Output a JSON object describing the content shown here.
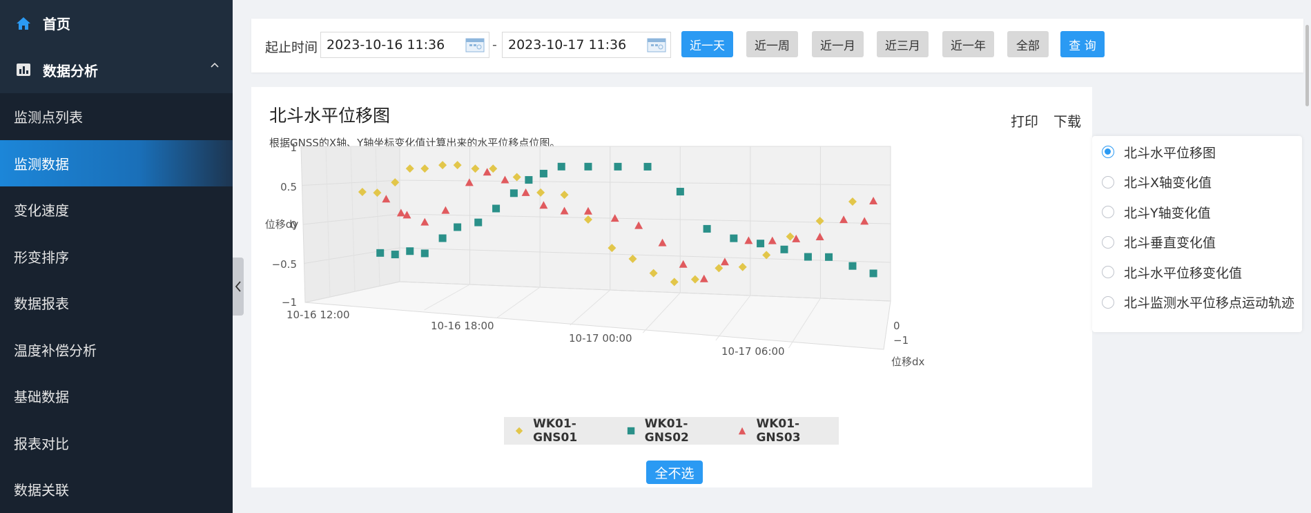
{
  "sidebar": {
    "home": "首页",
    "group": "数据分析",
    "items": [
      {
        "label": "监测点列表",
        "active": false
      },
      {
        "label": "监测数据",
        "active": true
      },
      {
        "label": "变化速度",
        "active": false
      },
      {
        "label": "形变排序",
        "active": false
      },
      {
        "label": "数据报表",
        "active": false
      },
      {
        "label": "温度补偿分析",
        "active": false
      },
      {
        "label": "基础数据",
        "active": false
      },
      {
        "label": "报表对比",
        "active": false
      },
      {
        "label": "数据关联",
        "active": false
      }
    ]
  },
  "filter": {
    "label": "起止时间",
    "start": "2023-10-16 11:36",
    "separator": "-",
    "end": "2023-10-17 11:36",
    "quick": [
      "近一天",
      "近一周",
      "近一月",
      "近三月",
      "近一年",
      "全部"
    ],
    "query": "查 询"
  },
  "panel": {
    "title": "北斗水平位移图",
    "subtitle": "根据GNSS的X轴、Y轴坐标变化值计算出来的水平位移点位图。",
    "print": "打印",
    "download": "下载",
    "clear_all": "全不选"
  },
  "options": [
    "北斗水平位移图",
    "北斗X轴变化值",
    "北斗Y轴变化值",
    "北斗垂直变化值",
    "北斗水平位移变化值",
    "北斗监测水平位移点运动轨迹"
  ],
  "chart_data": {
    "type": "scatter",
    "title": "",
    "x_axis": {
      "label": "",
      "ticks": [
        "10-16 12:00",
        "10-16 18:00",
        "10-17 00:00",
        "10-17 06:00"
      ]
    },
    "y_axis": {
      "label": "位移dy",
      "ticks": [
        "1",
        "0.5",
        "0",
        "−0.5",
        "−1"
      ],
      "ylim": [
        -1,
        1
      ]
    },
    "z_axis": {
      "label": "位移dx",
      "ticks": [
        "0",
        "−1"
      ]
    },
    "grid": true,
    "legend_position": "bottom",
    "series": [
      {
        "name": "WK01-GNS01",
        "color": "#e2c64a",
        "shape": "diamond",
        "points": [
          [
            11.8,
            0.48
          ],
          [
            12.3,
            0.47
          ],
          [
            12.9,
            0.62
          ],
          [
            13.4,
            0.82
          ],
          [
            13.9,
            0.82
          ],
          [
            14.5,
            0.87
          ],
          [
            15.0,
            0.87
          ],
          [
            15.6,
            0.82
          ],
          [
            16.2,
            0.82
          ],
          [
            17.0,
            0.7
          ],
          [
            17.8,
            0.48
          ],
          [
            18.6,
            0.45
          ],
          [
            19.4,
            0.1
          ],
          [
            20.2,
            -0.3
          ],
          [
            20.9,
            -0.45
          ],
          [
            21.6,
            -0.65
          ],
          [
            22.3,
            -0.77
          ],
          [
            23.0,
            -0.73
          ],
          [
            23.8,
            -0.57
          ],
          [
            24.6,
            -0.55
          ],
          [
            25.4,
            -0.38
          ],
          [
            26.2,
            -0.12
          ],
          [
            27.2,
            0.1
          ],
          [
            28.3,
            0.37
          ]
        ]
      },
      {
        "name": "WK01-GNS02",
        "color": "#2a9089",
        "shape": "square",
        "points": [
          [
            12.4,
            -0.4
          ],
          [
            12.9,
            -0.42
          ],
          [
            13.4,
            -0.37
          ],
          [
            13.9,
            -0.4
          ],
          [
            14.5,
            -0.18
          ],
          [
            15.0,
            -0.02
          ],
          [
            15.7,
            0.05
          ],
          [
            16.3,
            0.25
          ],
          [
            16.9,
            0.47
          ],
          [
            17.4,
            0.66
          ],
          [
            17.9,
            0.75
          ],
          [
            18.5,
            0.85
          ],
          [
            19.4,
            0.85
          ],
          [
            20.4,
            0.85
          ],
          [
            21.4,
            0.85
          ],
          [
            22.5,
            0.5
          ],
          [
            23.4,
            -0.02
          ],
          [
            24.3,
            -0.15
          ],
          [
            25.2,
            -0.22
          ],
          [
            26.0,
            -0.3
          ],
          [
            26.8,
            -0.4
          ],
          [
            27.5,
            -0.4
          ],
          [
            28.3,
            -0.52
          ],
          [
            29.0,
            -0.62
          ]
        ]
      },
      {
        "name": "WK01-GNS03",
        "color": "#e05a5e",
        "shape": "triangle",
        "points": [
          [
            12.6,
            0.38
          ],
          [
            13.1,
            0.18
          ],
          [
            13.3,
            0.15
          ],
          [
            13.9,
            0.05
          ],
          [
            14.6,
            0.22
          ],
          [
            15.4,
            0.62
          ],
          [
            16.0,
            0.77
          ],
          [
            16.6,
            0.66
          ],
          [
            17.3,
            0.48
          ],
          [
            17.9,
            0.3
          ],
          [
            18.6,
            0.22
          ],
          [
            19.4,
            0.22
          ],
          [
            20.3,
            0.12
          ],
          [
            21.1,
            0.02
          ],
          [
            21.9,
            -0.22
          ],
          [
            22.6,
            -0.52
          ],
          [
            23.3,
            -0.72
          ],
          [
            24.0,
            -0.48
          ],
          [
            24.8,
            -0.18
          ],
          [
            25.6,
            -0.18
          ],
          [
            26.4,
            -0.15
          ],
          [
            27.2,
            -0.12
          ],
          [
            28.0,
            0.12
          ],
          [
            28.7,
            0.1
          ],
          [
            29.0,
            0.38
          ]
        ]
      }
    ]
  }
}
